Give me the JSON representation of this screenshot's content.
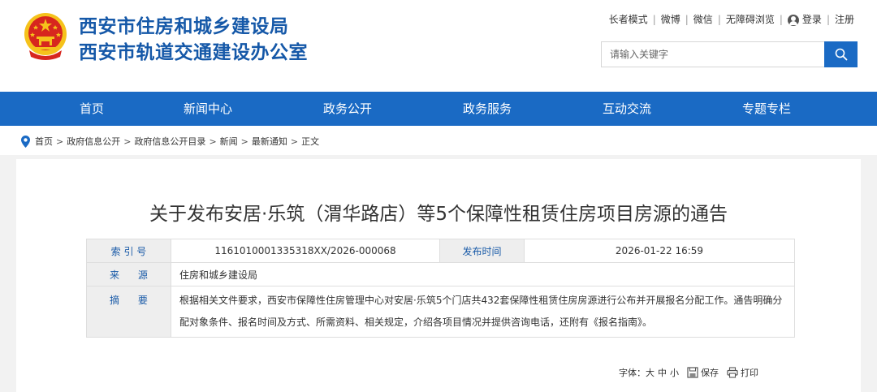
{
  "header": {
    "title_line1": "西安市住房和城乡建设局",
    "title_line2": "西安市轨道交通建设办公室",
    "top_links": [
      "长者模式",
      "微博",
      "微信",
      "无障碍浏览",
      "登录",
      "注册"
    ],
    "search_placeholder": "请输入关键字"
  },
  "nav": {
    "items": [
      "首页",
      "新闻中心",
      "政务公开",
      "政务服务",
      "互动交流",
      "专题专栏"
    ]
  },
  "breadcrumb": {
    "items": [
      "首页",
      "政府信息公开",
      "政府信息公开目录",
      "新闻",
      "最新通知"
    ],
    "current": "正文",
    "separator": ">"
  },
  "article": {
    "title": "关于发布安居·乐筑（渭华路店）等5个保障性租赁住房项目房源的通告",
    "meta": {
      "index_label": "索 引 号",
      "index_value": "1161010001335318XX/2026-000068",
      "date_label": "发布时间",
      "date_value": "2026-01-22 16:59",
      "source_label": "来      源",
      "source_value": "住房和城乡建设局",
      "summary_label": "摘      要",
      "summary_value": "根据相关文件要求，西安市保障性住房管理中心对安居·乐筑5个门店共432套保障性租赁住房房源进行公布并开展报名分配工作。通告明确分配对象条件、报名时间及方式、所需资料、相关规定，介绍各项目情况并提供咨询电话，还附有《报名指南》。"
    }
  },
  "toolbar": {
    "font_label": "字体：",
    "font_large": "大",
    "font_medium": "中",
    "font_small": "小",
    "save_label": "保存",
    "print_label": "打印"
  },
  "colors": {
    "brand_blue": "#1a6ac4",
    "title_blue": "#1558a8",
    "emblem_red": "#d7261e",
    "emblem_gold": "#f5c21b"
  }
}
